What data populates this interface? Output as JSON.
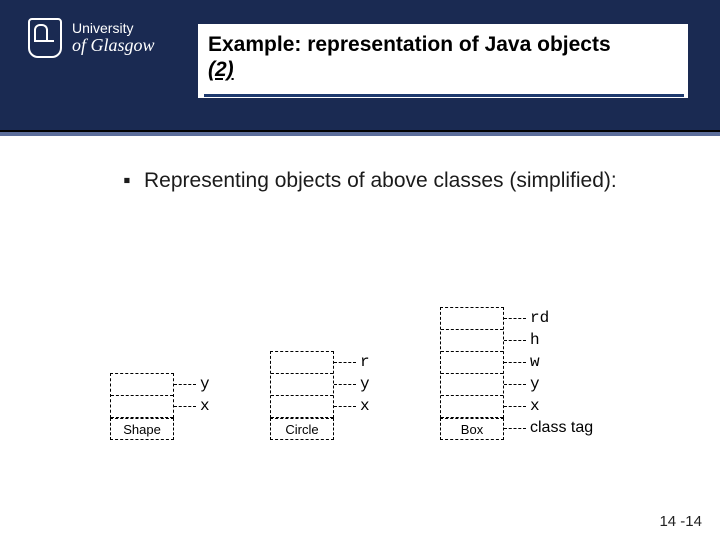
{
  "logo": {
    "line1": "University",
    "line2": "of Glasgow"
  },
  "title": {
    "main": "Example: representation of Java objects",
    "sub": "(2)"
  },
  "bullet_mark": "▪",
  "bullet_text": "Representing objects of above classes (simplified):",
  "shape": {
    "tag": "Shape",
    "fields": [
      "y",
      "x"
    ]
  },
  "circle": {
    "tag": "Circle",
    "fields": [
      "r",
      "y",
      "x"
    ]
  },
  "box": {
    "tag": "Box",
    "fields": [
      "rd",
      "h",
      "w",
      "y",
      "x"
    ],
    "taglabel": "class tag"
  },
  "pagenum": "14 -14"
}
